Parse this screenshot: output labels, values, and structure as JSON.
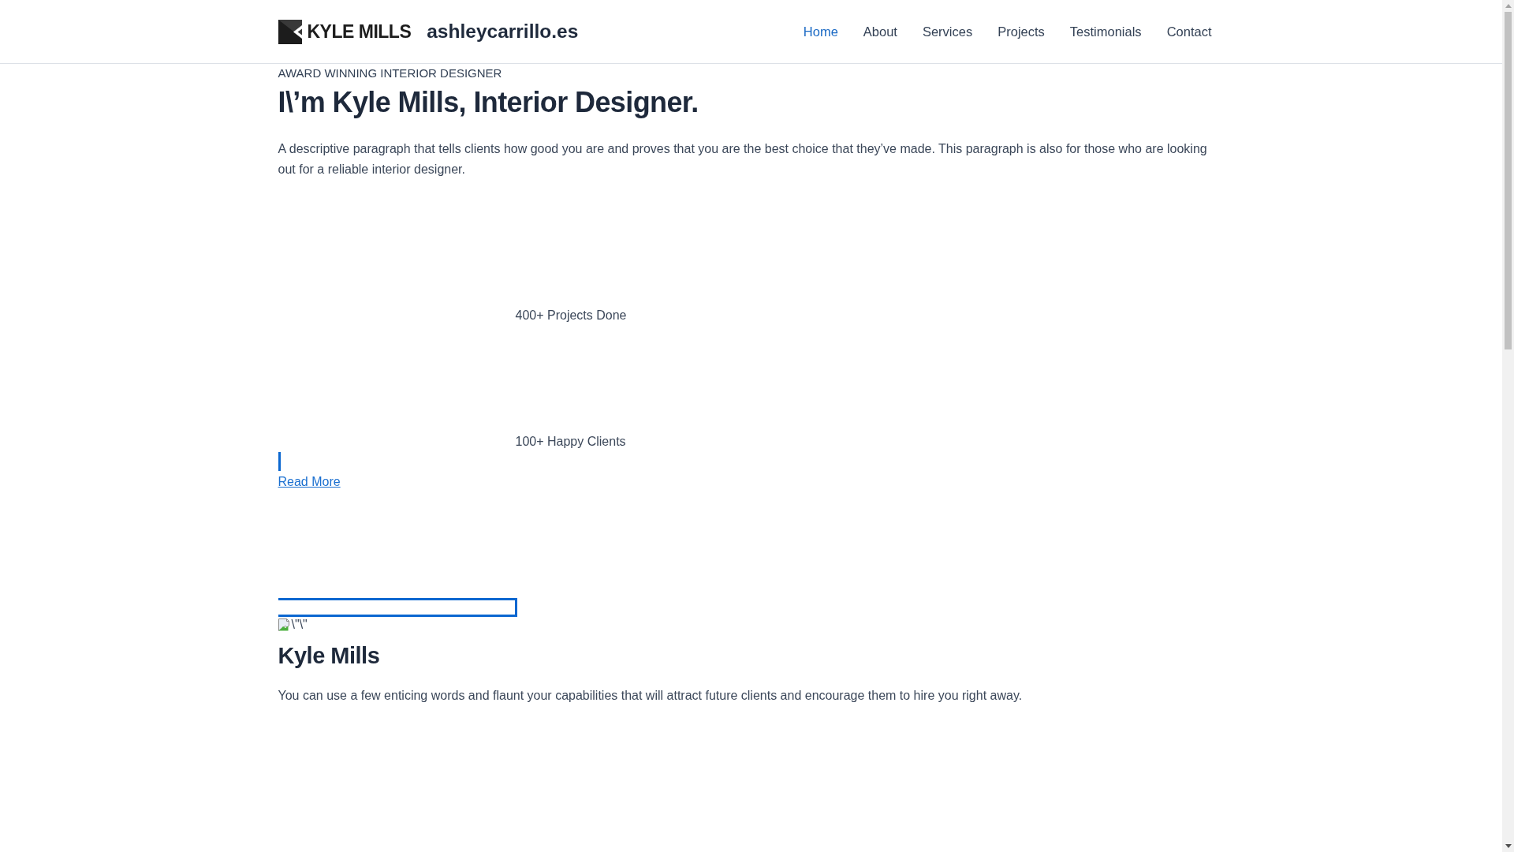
{
  "header": {
    "logo": {
      "text": "KYLE MILLS"
    },
    "site_title": "ashleycarrillo.es",
    "nav": [
      {
        "label": "Home",
        "selected": true
      },
      {
        "label": "About",
        "selected": false
      },
      {
        "label": "Services",
        "selected": false
      },
      {
        "label": "Projects",
        "selected": false
      },
      {
        "label": "Testimonials",
        "selected": false
      },
      {
        "label": "Contact",
        "selected": false
      }
    ]
  },
  "hero": {
    "eyebrow": "AWARD WINNING INTERIOR DESIGNER",
    "heading": "I\\’m Kyle Mills, Interior Designer.",
    "paragraph": "A descriptive paragraph that tells clients how good you are and proves that you are the best choice that they’ve made. This paragraph is also for those who are looking out for a reliable interior designer.",
    "stats": [
      "400+ Projects Done",
      "100+ Happy Clients"
    ],
    "link": "Read More"
  },
  "about": {
    "image_alt": "\\\"\\\"",
    "heading": "Kyle Mills",
    "paragraph": "You can use a few enticing words and flaunt your capabilities that will attract future clients and encourage them to hire you right away."
  }
}
